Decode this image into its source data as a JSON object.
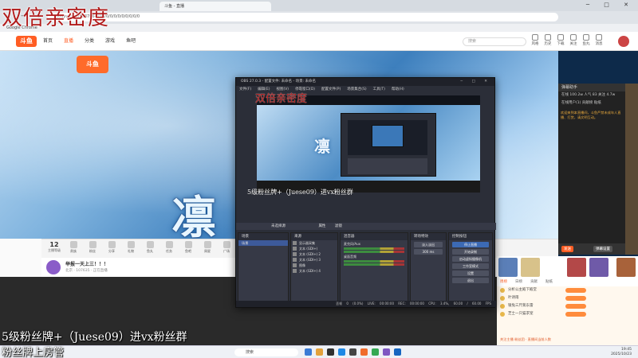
{
  "overlay": {
    "title": "双倍亲密度",
    "obs_title": "双倍亲密度",
    "line1": "5级粉丝牌+（Juese09）进vx粉丝群",
    "line2": "粉丝牌上房管",
    "inner_caption": "5级粉丝牌+（Juese09）进vx粉丝群"
  },
  "browser": {
    "tab_title": "斗鱼 - 直播",
    "address": "douyu.com/9937064793/0/0/0/0/0/0/0/0/0",
    "bookmarks": "Google Chrome",
    "window_controls": "─ □ ✕"
  },
  "site": {
    "logo": "斗鱼",
    "nav": [
      "首页",
      "直播",
      "分类",
      "游戏",
      "鱼吧"
    ],
    "search_placeholder": "搜索",
    "header_icons": [
      "风格",
      "历史",
      "下载",
      "关注",
      "鱼丸",
      "消息"
    ]
  },
  "stream": {
    "logo": "斗鱼",
    "big_char": "凛"
  },
  "toolbar": {
    "level": "12",
    "level_label": "主播等级",
    "items": [
      "贵族",
      "粉丝",
      "分享",
      "礼物",
      "鱼丸",
      "任务",
      "鱼吧",
      "周星",
      "广场",
      "推荐",
      "活动"
    ]
  },
  "streamer": {
    "name": "举报一天上三！！！",
    "meta": "北京 · 107635 · 正在直播"
  },
  "chat": {
    "title": "弹幕助手",
    "row1": "在线 100.2w   人气 83   关注 4.7w",
    "row2": "在线用户(1)   贡献榜   贴纸",
    "notice": "欢迎来到本直播间，斗鱼严禁未成年人直播、打赏，请文明互动。",
    "btn1": "发送",
    "btn2": "弹幕设置"
  },
  "rank": {
    "tabs": [
      "周榜",
      "日榜",
      "贡献",
      "贴纸"
    ],
    "rows": [
      "分析公主殿下殿堂",
      "叶诗雨",
      "银兔三尺蒋东雷",
      "芝士一只猫求宠"
    ],
    "footer": "关注主播 粉丝团 · 直播间当前人数"
  },
  "obs": {
    "title": "OBS 27.0.3 - 配置文件: 未命名 - 场景: 未命名",
    "menu": [
      "文件(F)",
      "编辑(E)",
      "视图(V)",
      "停靠窗口(D)",
      "配置文件(P)",
      "场景集合(S)",
      "工具(T)",
      "帮助(H)"
    ],
    "scene_bar_left": "未选择源",
    "scene_bar_right": "属性",
    "scene_bar_filter": "滤镜",
    "docks": {
      "scenes": "场景",
      "sources": "来源",
      "mixer": "混音器",
      "transitions": "转场特效",
      "controls": "控制按钮"
    },
    "scene_items": [
      "场景"
    ],
    "sources": [
      "显示器采集",
      "文本 (GDI+)",
      "文本 (GDI+) 2",
      "文本 (GDI+) 3",
      "图像",
      "文本 (GDI+) 4"
    ],
    "mixer": [
      "麦克风/Aux",
      "桌面音频"
    ],
    "transition": "淡入淡出",
    "duration": "300 ms",
    "controls": [
      "停止直播",
      "开始录制",
      "启动虚拟摄像机",
      "工作室模式",
      "设置",
      "退出"
    ],
    "status": "丢帧 0 (0.0%)   LIVE: 00:00:00   REC: 00:00:00   CPU: 3.4%, 60.00 / 60.00 FPS"
  },
  "taskbar": {
    "search": "搜索",
    "time": "19:45",
    "date": "2025/10/23"
  }
}
